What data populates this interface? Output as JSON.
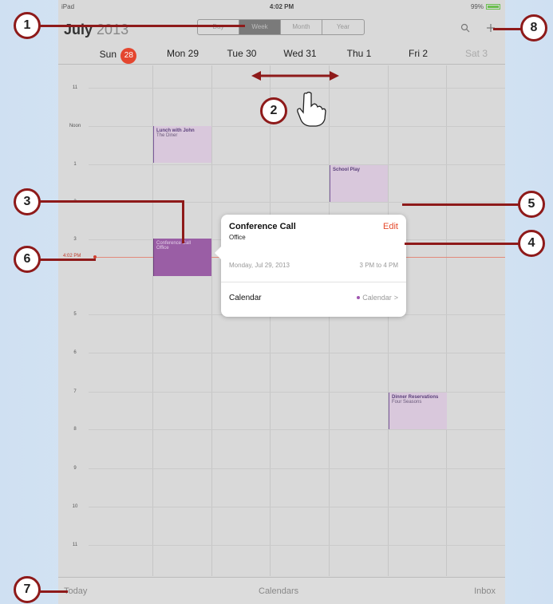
{
  "status_bar": {
    "device": "iPad",
    "time": "4:02 PM",
    "battery": "99%"
  },
  "header": {
    "month": "July",
    "year": "2013",
    "segments": [
      "Day",
      "Week",
      "Month",
      "Year"
    ],
    "active_segment": "Week",
    "icons": [
      "search-icon",
      "add-icon"
    ]
  },
  "week_days": [
    {
      "name": "Sun",
      "num": "28"
    },
    {
      "name": "Mon 29"
    },
    {
      "name": "Tue 30"
    },
    {
      "name": "Wed 31"
    },
    {
      "name": "Thu 1"
    },
    {
      "name": "Fri 2"
    },
    {
      "name": "Sat 3"
    }
  ],
  "hours": [
    "11",
    "Noon",
    "1",
    "2",
    "3",
    "",
    "5",
    "6",
    "7",
    "8",
    "9",
    "10",
    "11"
  ],
  "now_label": "4:02 PM",
  "events": {
    "lunch": {
      "title": "Lunch with John",
      "location": "The Diner"
    },
    "school": {
      "title": "School Play"
    },
    "dinner": {
      "title": "Dinner Reservations",
      "location": "Four Seasons"
    },
    "conference": {
      "title": "Conference Call",
      "location": "Office"
    }
  },
  "popover": {
    "title": "Conference Call",
    "location": "Office",
    "edit": "Edit",
    "date": "Monday, Jul 29, 2013",
    "time": "3 PM to 4 PM",
    "calendar_label": "Calendar",
    "calendar_value": "Calendar",
    "chevron": ">"
  },
  "toolbar": {
    "today": "Today",
    "calendars": "Calendars",
    "inbox": "Inbox"
  },
  "callouts": [
    "1",
    "2",
    "3",
    "4",
    "5",
    "6",
    "7",
    "8"
  ],
  "colors": {
    "accent_red": "#e54b2d",
    "callout_border": "#8e1a1a",
    "event_fill": "#d9c8dc",
    "selected_event": "#9a5ea5",
    "today_badge": "#e4462f"
  }
}
